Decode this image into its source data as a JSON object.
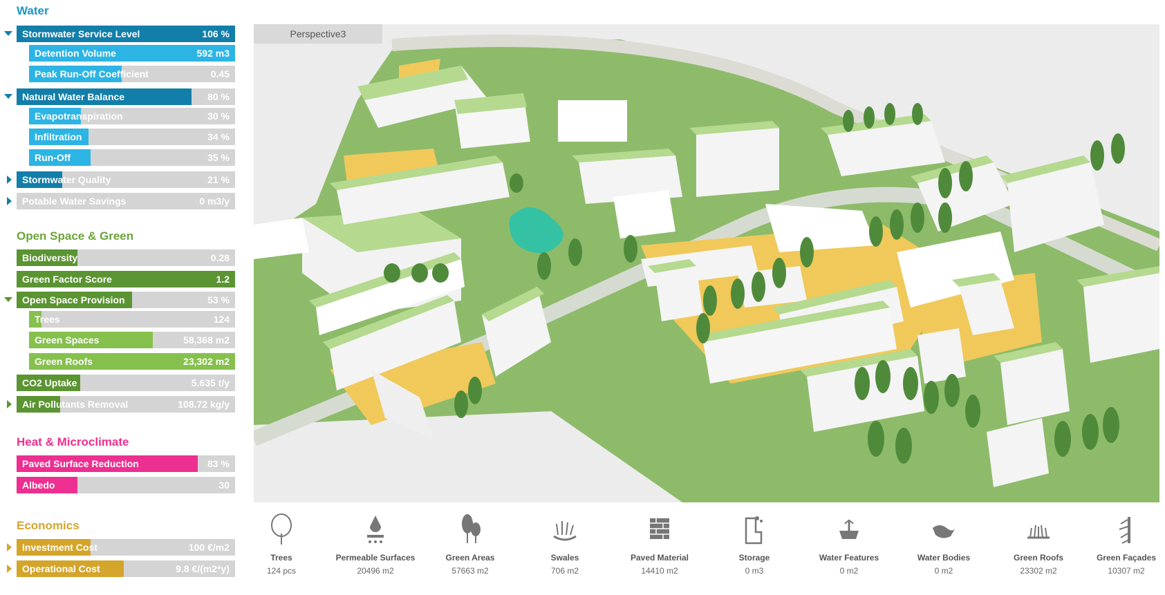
{
  "colors": {
    "water": "#1a96c6",
    "water_dark": "#127ea9",
    "water_sub": "#2cb4e4",
    "green": "#6ba43a",
    "green_dark": "#5b9432",
    "green_sub": "#86c04d",
    "heat": "#ec2f90",
    "econ": "#d4a52b",
    "bar_bg": "#d4d4d4"
  },
  "sections": {
    "water": {
      "title": "Water",
      "rows": [
        {
          "label": "Stormwater Service Level",
          "value": "106 %",
          "fraction": 1.0
        },
        {
          "label": "Detention Volume",
          "value": "592 m3",
          "fraction": 1.0
        },
        {
          "label": "Peak Run-Off Coefficient",
          "value": "0.45",
          "fraction": 0.45
        },
        {
          "label": "Natural Water Balance",
          "value": "80 %",
          "fraction": 0.8
        },
        {
          "label": "Evapotranspiration",
          "value": "30 %",
          "fraction": 0.3
        },
        {
          "label": "Infiltration",
          "value": "34 %",
          "fraction": 0.34
        },
        {
          "label": "Run-Off",
          "value": "35 %",
          "fraction": 0.35
        },
        {
          "label": "Stormwater Quality",
          "value": "21 %",
          "fraction": 0.21
        },
        {
          "label": "Potable Water Savings",
          "value": "0 m3/y",
          "fraction": 0.0
        }
      ]
    },
    "open_space": {
      "title": "Open Space & Green",
      "rows": [
        {
          "label": "Biodiversity",
          "value": "0.28",
          "fraction": 0.28
        },
        {
          "label": "Green Factor Score",
          "value": "1.2",
          "fraction": 1.0
        },
        {
          "label": "Open Space Provision",
          "value": "53 %",
          "fraction": 0.53
        },
        {
          "label": "Trees",
          "value": "124",
          "fraction": 0.06
        },
        {
          "label": "Green Spaces",
          "value": "58,368 m2",
          "fraction": 0.6
        },
        {
          "label": "Green Roofs",
          "value": "23,302 m2",
          "fraction": 1.0
        },
        {
          "label": "CO2 Uptake",
          "value": "5.635 t/y",
          "fraction": 0.29
        },
        {
          "label": "Air Pollutants Removal",
          "value": "108.72 kg/y",
          "fraction": 0.2
        }
      ]
    },
    "heat": {
      "title": "Heat & Microclimate",
      "rows": [
        {
          "label": "Paved Surface Reduction",
          "value": "83 %",
          "fraction": 0.83
        },
        {
          "label": "Albedo",
          "value": "30",
          "fraction": 0.3
        }
      ]
    },
    "economics": {
      "title": "Economics",
      "rows": [
        {
          "label": "Investment Cost",
          "value": "100 €/m2",
          "fraction": 0.34
        },
        {
          "label": "Operational Cost",
          "value": "9.8 €/(m2*y)",
          "fraction": 0.49
        }
      ]
    }
  },
  "view": {
    "tab_label": "Perspective3"
  },
  "toolbar": [
    {
      "name": "Trees",
      "value": "124 pcs",
      "icon": "tree-icon"
    },
    {
      "name": "Permeable Surfaces",
      "value": "20496 m2",
      "icon": "permeable-surface-icon"
    },
    {
      "name": "Green Areas",
      "value": "57663 m2",
      "icon": "green-areas-icon"
    },
    {
      "name": "Swales",
      "value": "706 m2",
      "icon": "swale-icon"
    },
    {
      "name": "Paved Material",
      "value": "14410 m2",
      "icon": "brick-icon"
    },
    {
      "name": "Storage",
      "value": "0 m3",
      "icon": "storage-icon"
    },
    {
      "name": "Water Features",
      "value": "0 m2",
      "icon": "fountain-icon"
    },
    {
      "name": "Water Bodies",
      "value": "0 m2",
      "icon": "water-body-icon"
    },
    {
      "name": "Green Roofs",
      "value": "23302 m2",
      "icon": "green-roof-icon"
    },
    {
      "name": "Green Façades",
      "value": "10307 m2",
      "icon": "green-facade-icon"
    }
  ]
}
